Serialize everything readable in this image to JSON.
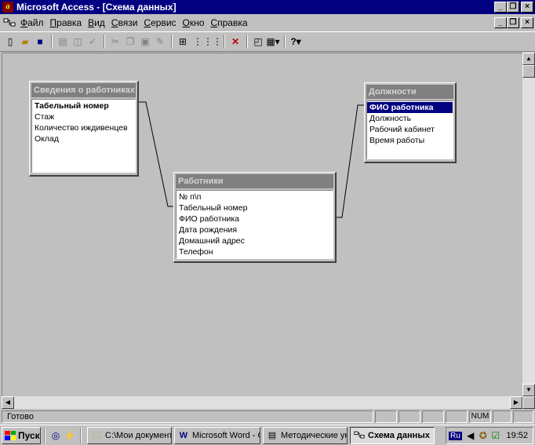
{
  "window": {
    "title": "Microsoft Access - [Схема данных]"
  },
  "menu": [
    "Файл",
    "Правка",
    "Вид",
    "Связи",
    "Сервис",
    "Окно",
    "Справка"
  ],
  "tables": {
    "svedenia": {
      "title": "Сведения о работниках",
      "fields": [
        "Табельный номер",
        "Стаж",
        "Количество иждивенцев",
        "Оклад"
      ]
    },
    "rabotniki": {
      "title": "Работники",
      "fields": [
        "№ п\\п",
        "Табельный номер",
        "ФИО работника",
        "Дата рождения",
        "Домашний адрес",
        "Телефон"
      ]
    },
    "dolzhnosti": {
      "title": "Должности",
      "fields": [
        "ФИО работника",
        "Должность",
        "Рабочий кабинет",
        "Время работы"
      ]
    }
  },
  "status": {
    "text": "Готово",
    "num": "NUM"
  },
  "taskbar": {
    "start": "Пуск",
    "tasks": [
      "C:\\Мои документы",
      "Microsoft Word - СУ...",
      "Методические ука...",
      "Схема данных"
    ],
    "lang": "Ru",
    "clock": "19:52"
  },
  "colors": {
    "titlebar": "#000080",
    "face": "#c0c0c0",
    "table_header": "#808080",
    "selection": "#000080"
  }
}
